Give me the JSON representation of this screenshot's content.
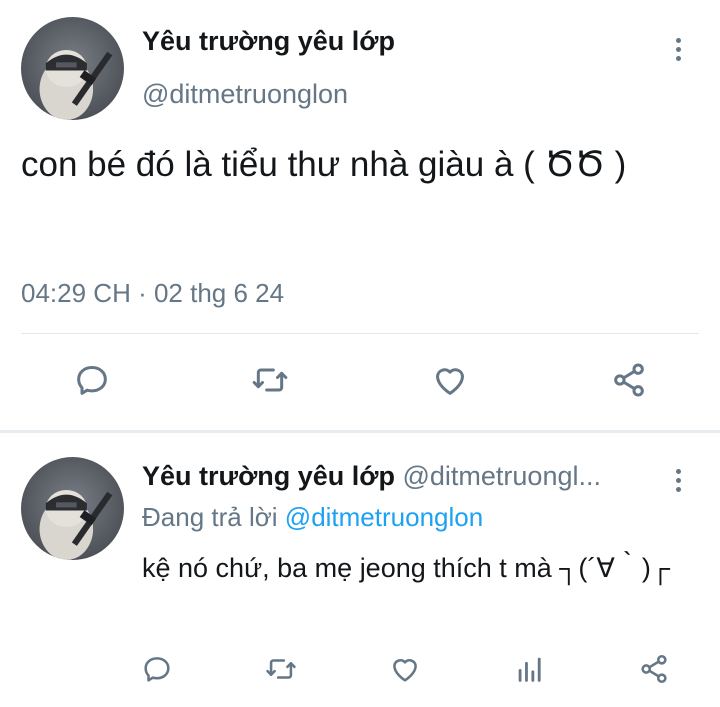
{
  "main_tweet": {
    "author_name": "Yêu trường yêu lớp",
    "handle": "@ditmetruonglon",
    "text": "con bé đó là tiểu thư nhà giàu à ( ԾԾ )",
    "timestamp": "04:29 CH · 02 thg 6 24",
    "actions": [
      "reply-icon",
      "retweet-icon",
      "like-icon",
      "share-icon"
    ]
  },
  "reply_tweet": {
    "author_name": "Yêu trường yêu lớp",
    "handle": "@ditmetruongl...",
    "replying_prefix": "Đang trả lời",
    "replying_to": "@ditmetruonglon",
    "text": "kệ nó chứ, ba mẹ jeong thích t mà ┐(´∀｀)┌",
    "actions": [
      "reply-icon",
      "retweet-icon",
      "like-icon",
      "analytics-icon",
      "share-icon"
    ]
  },
  "colors": {
    "text": "#14171a",
    "secondary": "#657786",
    "link": "#1da1f2",
    "divider": "#e1e8ed"
  }
}
